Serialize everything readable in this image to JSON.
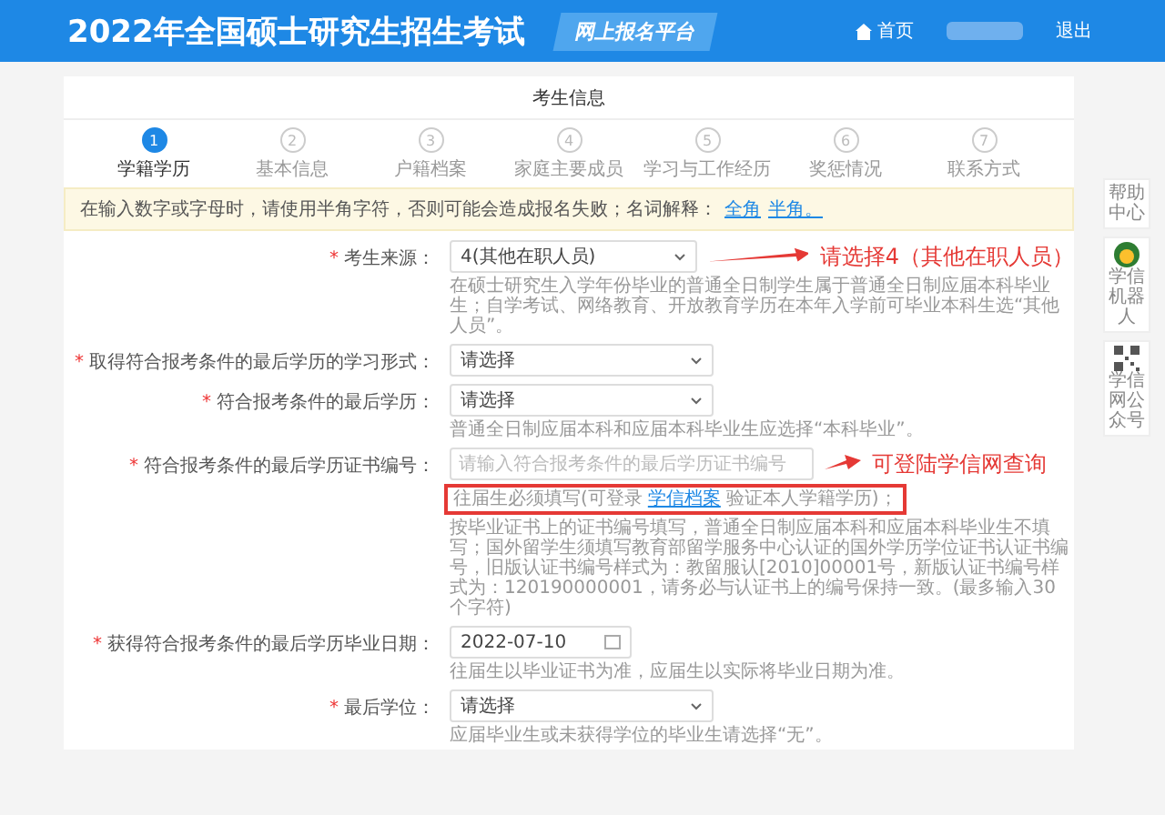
{
  "header": {
    "title": "2022年全国硕士研究生招生考试",
    "badge": "网上报名平台",
    "home": "首页",
    "logout": "退出"
  },
  "card": {
    "title": "考生信息"
  },
  "steps": [
    {
      "number": "1",
      "label": "学籍学历",
      "selected": true
    },
    {
      "number": "2",
      "label": "基本信息",
      "selected": false
    },
    {
      "number": "3",
      "label": "户籍档案",
      "selected": false
    },
    {
      "number": "4",
      "label": "家庭主要成员",
      "selected": false
    },
    {
      "number": "5",
      "label": "学习与工作经历",
      "selected": false
    },
    {
      "number": "6",
      "label": "奖惩情况",
      "selected": false
    },
    {
      "number": "7",
      "label": "联系方式",
      "selected": false
    }
  ],
  "notice": {
    "text": "在输入数字或字母时，请使用半角字符，否则可能会造成报名失败；名词解释：",
    "links": [
      "全角",
      "半角。"
    ]
  },
  "fields": [
    {
      "kind": "select",
      "required_mark": "*",
      "label": "考生来源：",
      "value": "4(其他在职人员)",
      "hint": "在硕士研究生入学年份毕业的普通全日制学生属于普通全日制应届本科毕业生；自学考试、网络教育、开放教育学历在本年入学前可毕业本科生选“其他人员”。",
      "annotation": "请选择4（其他在职人员）"
    },
    {
      "kind": "select",
      "required_mark": "*",
      "label": "取得符合报考条件的最后学历的学习形式：",
      "value": "请选择"
    },
    {
      "kind": "select",
      "required_mark": "*",
      "label": "符合报考条件的最后学历：",
      "value": "请选择",
      "hint": "普通全日制应届本科和应届本科毕业生应选择“本科毕业”。"
    },
    {
      "kind": "input",
      "required_mark": "*",
      "label": "符合报考条件的最后学历证书编号：",
      "placeholder": "请输入符合报考条件的最后学历证书编号",
      "hint_link_before": "往届生必须填写(可登录",
      "hint_link": "学信档案",
      "hint_link_after": "验证本人学籍学历)；",
      "hint": "按毕业证书上的证书编号填写，普通全日制应届本科和应届本科毕业生不填写；国外留学生须填写教育部留学服务中心认证的国外学历学位证书认证书编号，旧版认证书编号样式为：教留服认[2010]00001号，新版认证书编号样式为：120190000001，请务必与认证书上的编号保持一致。(最多输入30个字符)",
      "annotation": "可登陆学信网查询"
    },
    {
      "kind": "date",
      "required_mark": "*",
      "label": "获得符合报考条件的最后学历毕业日期：",
      "value": "2022-07-10",
      "hint": "往届生以毕业证书为准，应届生以实际将毕业日期为准。"
    },
    {
      "kind": "select",
      "required_mark": "*",
      "label": "最后学位：",
      "value": "请选择",
      "hint": "应届毕业生或未获得学位的毕业生请选择“无”。"
    }
  ],
  "side": [
    {
      "kind": "text",
      "label": "帮助中心"
    },
    {
      "kind": "robot",
      "label": "学信机器人"
    },
    {
      "kind": "qr",
      "label": "学信网公众号"
    }
  ]
}
